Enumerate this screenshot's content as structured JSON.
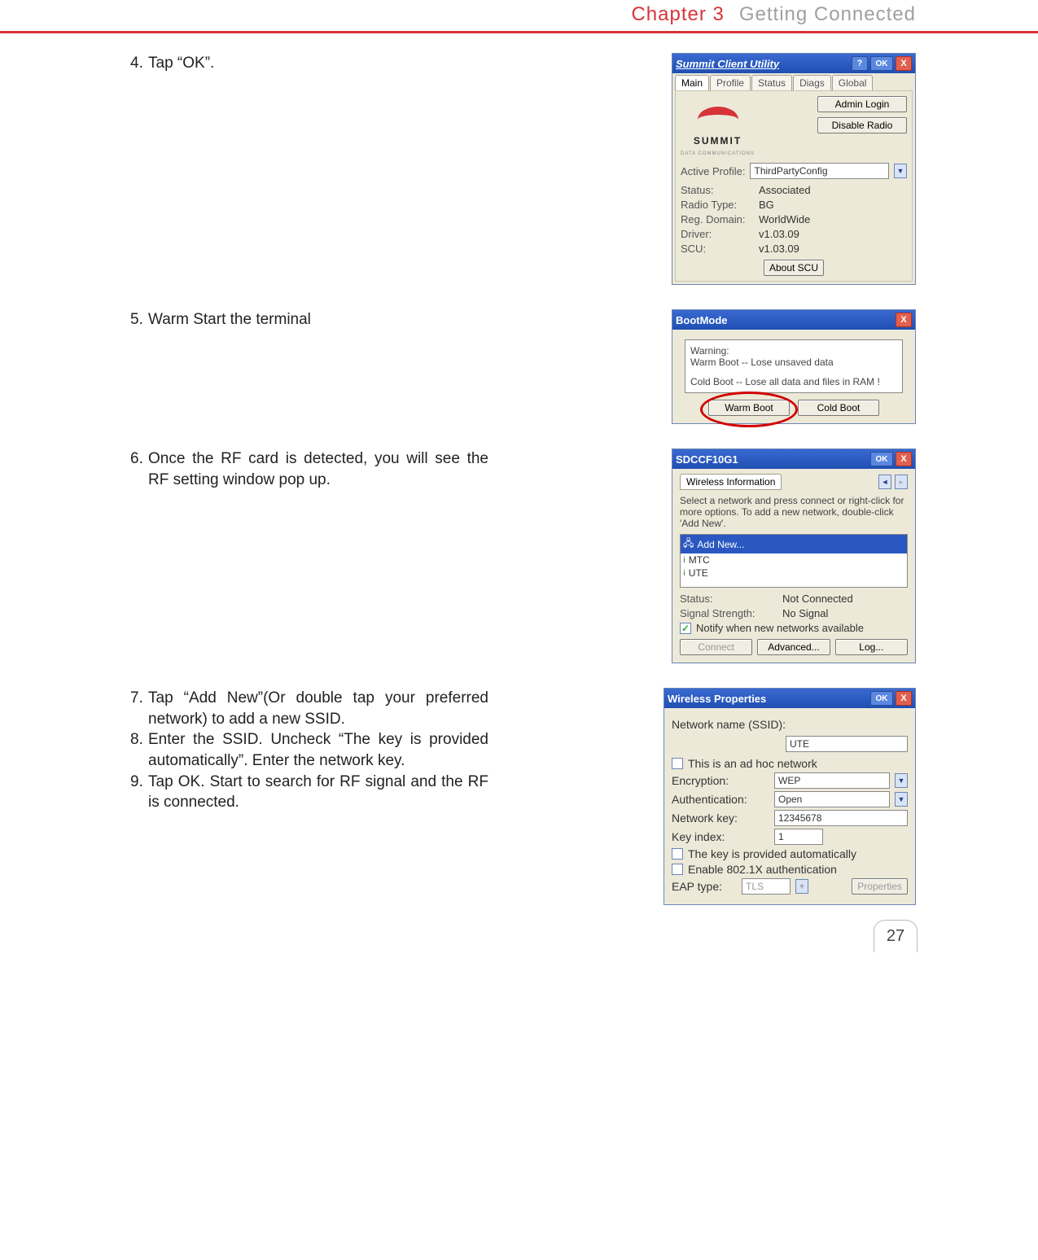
{
  "header": {
    "chapter": "Chapter 3",
    "title": "Getting Connected"
  },
  "page_number": "27",
  "steps": {
    "s4": "Tap “OK”.",
    "s5": "Warm Start the terminal",
    "s6": "Once the RF card is detected, you will see the RF setting window pop up.",
    "s7": "Tap “Add New”(Or double tap your preferred network) to add a new SSID.",
    "s8": "Enter the SSID. Uncheck “The key is provided automatically”. Enter the network key.",
    "s9": "Tap OK. Start to search for RF signal and the RF is connected."
  },
  "scu": {
    "title": "Summit Client Utility",
    "help": "?",
    "ok": "OK",
    "close": "X",
    "tabs": {
      "main": "Main",
      "profile": "Profile",
      "status": "Status",
      "diags": "Diags",
      "global": "Global"
    },
    "logo": "SUMMIT",
    "logo_sub": "DATA COMMUNICATIONS",
    "admin_login": "Admin Login",
    "disable_radio": "Disable Radio",
    "active_profile_lbl": "Active Profile:",
    "active_profile_val": "ThirdPartyConfig",
    "status_lbl": "Status:",
    "status_val": "Associated",
    "radio_type_lbl": "Radio Type:",
    "radio_type_val": "BG",
    "reg_domain_lbl": "Reg. Domain:",
    "reg_domain_val": "WorldWide",
    "driver_lbl": "Driver:",
    "driver_val": "v1.03.09",
    "scu_lbl": "SCU:",
    "scu_val": "v1.03.09",
    "about": "About SCU"
  },
  "boot": {
    "title": "BootMode",
    "close": "X",
    "warning_lbl": "Warning:",
    "warm_msg": "Warm Boot -- Lose unsaved data",
    "cold_msg": "Cold Boot -- Lose all data and files in RAM !",
    "warm_btn": "Warm Boot",
    "cold_btn": "Cold Boot"
  },
  "sdccf": {
    "title": "SDCCF10G1",
    "ok": "OK",
    "close": "X",
    "tab": "Wireless Information",
    "arrow": "◄",
    "instructions": "Select a network and press connect or right-click for more options.  To add a new network, double-click 'Add New'.",
    "list": {
      "addnew": "Add New...",
      "n1": "MTC",
      "n2": "UTE"
    },
    "status_lbl": "Status:",
    "status_val": "Not Connected",
    "signal_lbl": "Signal Strength:",
    "signal_val": "No Signal",
    "notify": "Notify when new networks available",
    "connect": "Connect",
    "advanced": "Advanced...",
    "log": "Log..."
  },
  "wprop": {
    "title": "Wireless Properties",
    "ok": "OK",
    "close": "X",
    "ssid_lbl": "Network name (SSID):",
    "ssid_val": "UTE",
    "adhoc": "This is an ad hoc network",
    "enc_lbl": "Encryption:",
    "enc_val": "WEP",
    "auth_lbl": "Authentication:",
    "auth_val": "Open",
    "key_lbl": "Network key:",
    "key_val": "12345678",
    "kidx_lbl": "Key index:",
    "kidx_val": "1",
    "auto_key": "The key is provided automatically",
    "enable_8021x": "Enable 802.1X authentication",
    "eap_lbl": "EAP type:",
    "eap_val": "TLS",
    "properties": "Properties"
  }
}
